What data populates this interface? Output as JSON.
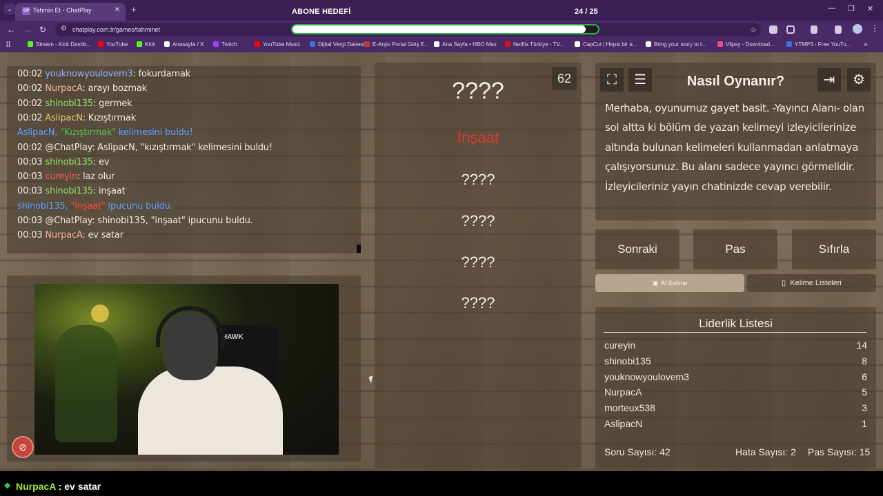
{
  "browser": {
    "tab_title": "Tahmin Et - ChatPlay",
    "tab_favicon": "CP",
    "url": "chatplay.com.tr/games/tahminet",
    "bookmarks": [
      {
        "label": "Stream - Kick Dashb...",
        "color": "#53fc18"
      },
      {
        "label": "YouTube",
        "color": "#ff0000"
      },
      {
        "label": "Kick",
        "color": "#53fc18"
      },
      {
        "label": "Anasayfa / X",
        "color": "#ffffff"
      },
      {
        "label": "Twitch",
        "color": "#9146ff"
      },
      {
        "label": "YouTube Music",
        "color": "#ff0000"
      },
      {
        "label": "Dijital Vergi Dairesi",
        "color": "#3c73d6"
      },
      {
        "label": "E-Arşiv Portal Giriş E...",
        "color": "#c0392b"
      },
      {
        "label": "Ana Sayfa • HBO Max",
        "color": "#ffffff"
      },
      {
        "label": "Netflix Türkiye - TV...",
        "color": "#e50914"
      },
      {
        "label": "CapCut | Hepsi bir a...",
        "color": "#ffffff"
      },
      {
        "label": "Bring your story to l...",
        "color": "#ffffff"
      },
      {
        "label": "Vlipsy - Download...",
        "color": "#e74c8c"
      },
      {
        "label": "YTMP3 - Free YouTu...",
        "color": "#3c73d6"
      }
    ]
  },
  "overlay": {
    "goal_title": "ABONE HEDEFİ",
    "goal_count": "24 / 25",
    "goal_progress": 0.96
  },
  "chat": [
    {
      "time": "00:02",
      "user": "youknowyoulovem3",
      "user_color": "#8ab4ff",
      "text": ": fokurdamak"
    },
    {
      "time": "00:02",
      "user": "NurpacA",
      "user_color": "#f0b6a0",
      "text": ": arayı bozmak"
    },
    {
      "time": "00:02",
      "user": "shinobi135",
      "user_color": "#8fe36a",
      "text": ": germek"
    },
    {
      "time": "00:02",
      "user": "AslipacN",
      "user_color": "#f0c46a",
      "text": ": Kızıştırmak"
    },
    {
      "system": true,
      "parts": [
        {
          "t": "AslipacN, ",
          "c": "#5aa0ff"
        },
        {
          "t": "\"Kızıştırmak\"",
          "c": "#52c84a"
        },
        {
          "t": " kelimesini buldu!",
          "c": "#5aa0ff"
        }
      ]
    },
    {
      "time": "00:02",
      "user": "@ChatPlay",
      "user_color": "#f1ebe2",
      "text": ": AslipacN, \"kızıştırmak\" kelimesini buldu!"
    },
    {
      "time": "00:03",
      "user": "shinobi135",
      "user_color": "#8fe36a",
      "text": ": ev"
    },
    {
      "time": "00:03",
      "user": "cureyin",
      "user_color": "#ff5a4a",
      "text": ": laz olur"
    },
    {
      "time": "00:03",
      "user": "shinobi135",
      "user_color": "#8fe36a",
      "text": ": inşaat"
    },
    {
      "system": true,
      "parts": [
        {
          "t": "shinobi135, ",
          "c": "#5aa0ff"
        },
        {
          "t": "\"İnşaat\"",
          "c": "#ff4a3a"
        },
        {
          "t": " ipucunu buldu.",
          "c": "#5aa0ff"
        }
      ]
    },
    {
      "time": "00:03",
      "user": "@ChatPlay",
      "user_color": "#f1ebe2",
      "text": ": shinobi135, \"inşaat\" ipucunu buldu."
    },
    {
      "time": "00:03",
      "user": "NurpacA",
      "user_color": "#f0b6a0",
      "text": ": ev satar"
    }
  ],
  "webcam": {
    "chair_text": "HAWK",
    "rec_icon": "no-entry-icon"
  },
  "game": {
    "timer": "62",
    "main_word": "????",
    "hints": [
      {
        "text": "İnşaat",
        "color": "#e03a2a",
        "revealed": true
      },
      {
        "text": "????",
        "color": "#f3eee7",
        "revealed": false
      },
      {
        "text": "????",
        "color": "#f3eee7",
        "revealed": false
      },
      {
        "text": "????",
        "color": "#f3eee7",
        "revealed": false
      },
      {
        "text": "????",
        "color": "#f3eee7",
        "revealed": false
      }
    ]
  },
  "info": {
    "title": "Nasıl Oynanır?",
    "text": "Merhaba, oyunumuz gayet basit. -Yayıncı Alanı- olan sol altta ki bölüm de yazan kelimeyi izleyicilerinize altında bulunan kelimeleri kullanmadan anlatmaya çalışıyorsunuz. Bu alanı sadece yayıncı görmelidir. İzleyicileriniz yayın chatinizde cevap verebilir.",
    "icons": [
      "fullscreen-icon",
      "document-icon",
      "exit-icon",
      "gear-icon"
    ]
  },
  "controls": {
    "next": "Sonraki",
    "pass": "Pas",
    "reset": "Sıfırla",
    "ai_word": "AI Kelime",
    "word_lists": "Kelime Listeleri"
  },
  "leaderboard": {
    "title": "Liderlik Listesi",
    "rows": [
      {
        "name": "cureyin",
        "score": "14"
      },
      {
        "name": "shinobi135",
        "score": "8"
      },
      {
        "name": "youknowyoulovem3",
        "score": "6"
      },
      {
        "name": "NurpacA",
        "score": "5"
      },
      {
        "name": "morteux538",
        "score": "3"
      },
      {
        "name": "AslipacN",
        "score": "1"
      }
    ],
    "question_label": "Soru Sayısı: 42",
    "error_label": "Hata Sayısı: 2",
    "pass_label": "Pas Sayısı: 15"
  },
  "bottom": {
    "user": "NurpacA",
    "message": " : ev satar",
    "icon": "diamond-icon"
  }
}
